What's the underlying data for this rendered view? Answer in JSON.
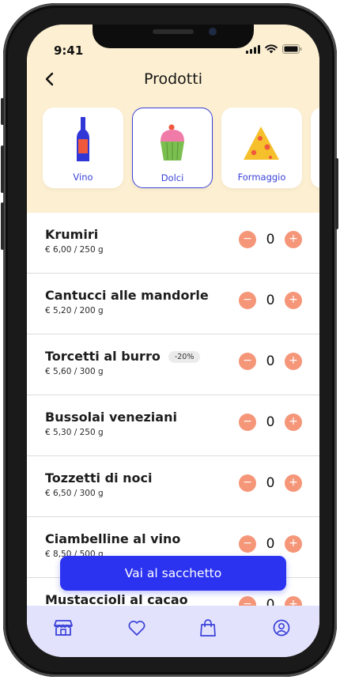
{
  "status": {
    "time": "9:41"
  },
  "header": {
    "title": "Prodotti"
  },
  "categories": [
    {
      "label": "Vino",
      "icon": "wine-bottle-icon"
    },
    {
      "label": "Dolci",
      "icon": "cupcake-icon",
      "selected": true
    },
    {
      "label": "Formaggio",
      "icon": "cheese-icon"
    }
  ],
  "products": [
    {
      "name": "Krumiri",
      "price": "€ 6,00 / 250 g",
      "qty": "0"
    },
    {
      "name": "Cantucci alle mandorle",
      "price": "€ 5,20 / 200 g",
      "qty": "0"
    },
    {
      "name": "Torcetti al burro",
      "price": "€ 5,60 / 300 g",
      "qty": "0",
      "badge": "-20%"
    },
    {
      "name": "Bussolai veneziani",
      "price": "€ 5,30 / 250 g",
      "qty": "0"
    },
    {
      "name": "Tozzetti di noci",
      "price": "€ 6,50 / 300 g",
      "qty": "0"
    },
    {
      "name": "Ciambelline al vino",
      "price": "€ 8,50 / 500 g",
      "qty": "0"
    },
    {
      "name": "Mustaccioli al cacao",
      "price": "",
      "qty": "0"
    }
  ],
  "stepper": {
    "minus": "−",
    "plus": "+"
  },
  "cta": {
    "label": "Vai al sacchetto"
  },
  "tabs": [
    {
      "icon": "shop-icon",
      "active": true
    },
    {
      "icon": "heart-icon"
    },
    {
      "icon": "shopping-bag-icon"
    },
    {
      "icon": "profile-icon"
    }
  ],
  "colors": {
    "header_bg": "#fdf0d2",
    "accent": "#2b33f0",
    "stepper": "#f59679",
    "tabbar_bg": "#e3e2fd"
  }
}
